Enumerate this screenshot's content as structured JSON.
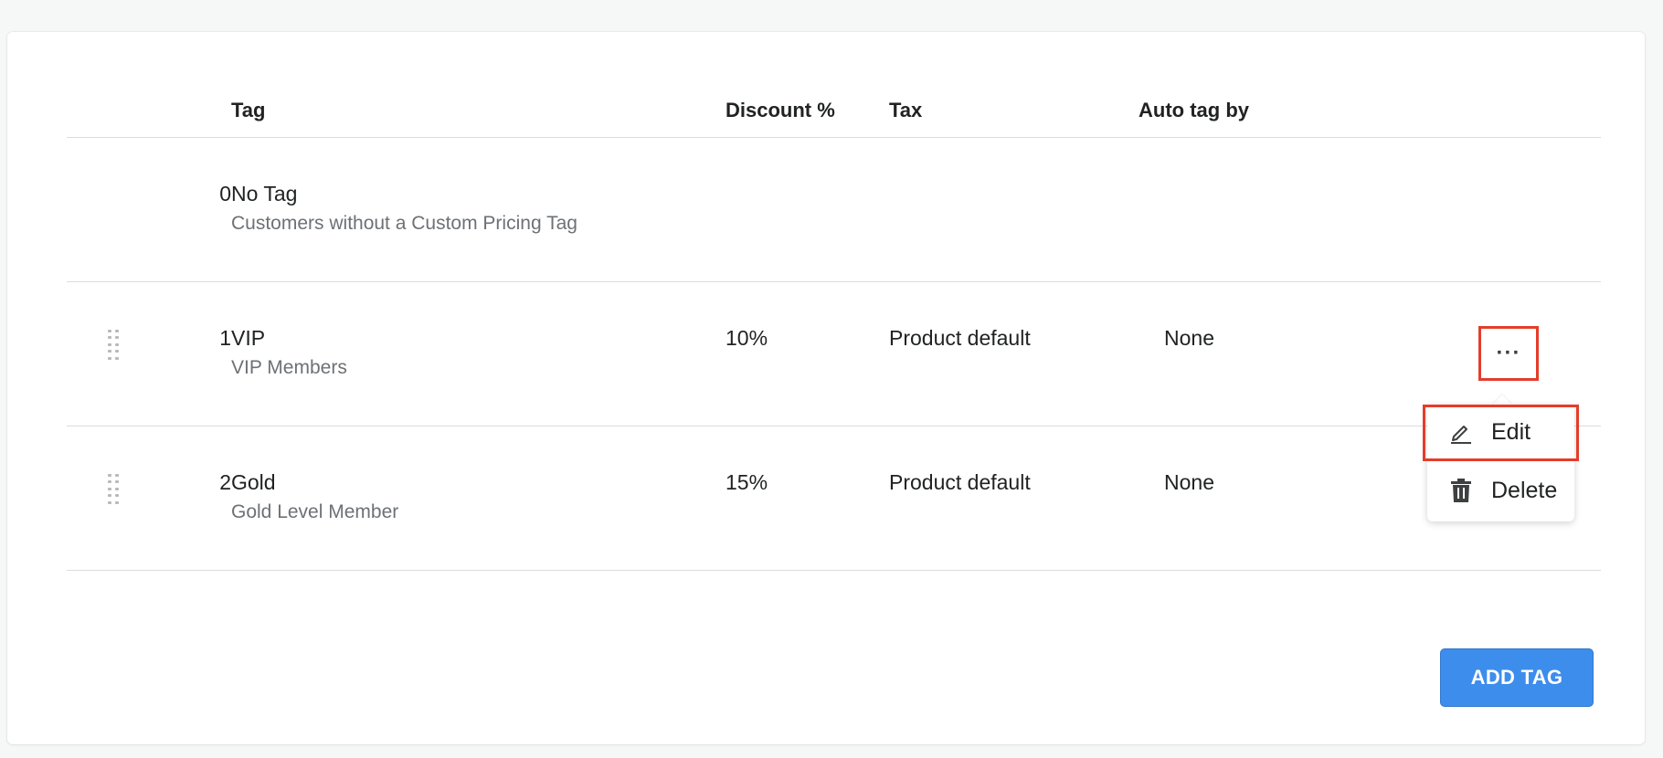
{
  "table": {
    "headers": {
      "tag": "Tag",
      "discount": "Discount %",
      "tax": "Tax",
      "auto_tag": "Auto tag by"
    },
    "rows": [
      {
        "index": "0",
        "name": "No Tag",
        "description": "Customers without a Custom Pricing Tag",
        "discount": "",
        "tax": "",
        "auto_tag": ""
      },
      {
        "index": "1",
        "name": "VIP",
        "description": "VIP Members",
        "discount": "10%",
        "tax": "Product default",
        "auto_tag": "None"
      },
      {
        "index": "2",
        "name": "Gold",
        "description": "Gold Level Member",
        "discount": "15%",
        "tax": "Product default",
        "auto_tag": "None"
      }
    ]
  },
  "row_actions": {
    "more_label": "···",
    "menu": {
      "edit_label": "Edit",
      "edit_icon": "pencil-icon",
      "delete_label": "Delete",
      "delete_icon": "trash-icon"
    }
  },
  "footer": {
    "add_button_label": "ADD TAG"
  },
  "colors": {
    "accent": "#3d8ded",
    "highlight": "#e43d2a"
  }
}
